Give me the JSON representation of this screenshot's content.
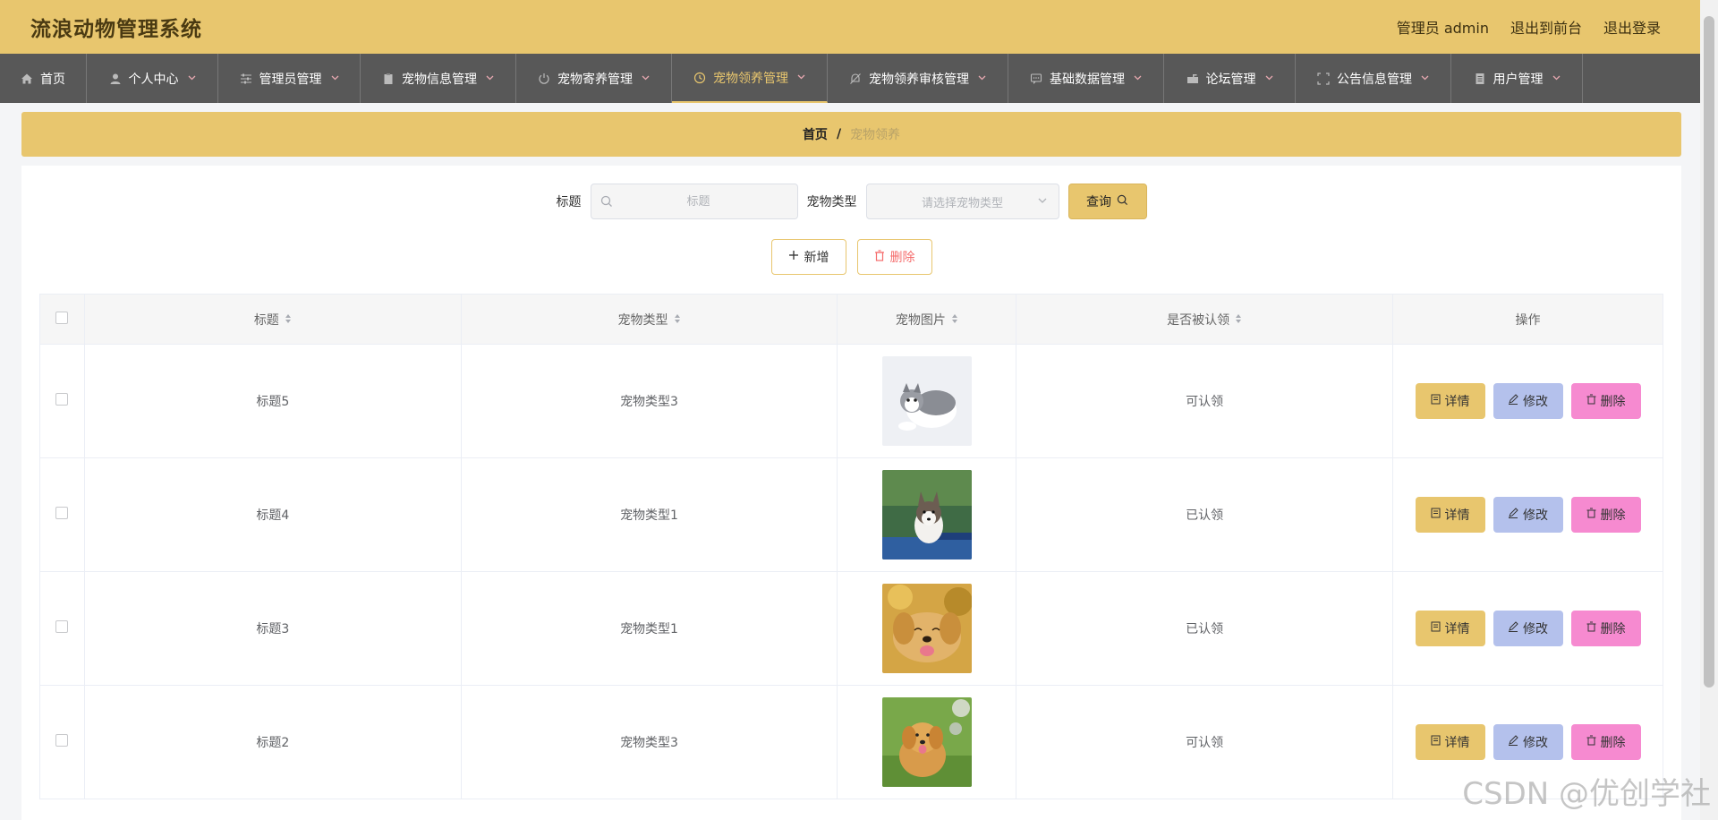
{
  "app": {
    "title": "流浪动物管理系统"
  },
  "header": {
    "user": "管理员 admin",
    "to_front": "退出到前台",
    "logout": "退出登录"
  },
  "nav": [
    {
      "label": "首页",
      "icon": "home-icon",
      "width": 97,
      "dropdown": false
    },
    {
      "label": "个人中心",
      "icon": "user-icon",
      "width": 147,
      "dropdown": true
    },
    {
      "label": "管理员管理",
      "icon": "sliders-icon",
      "width": 159,
      "dropdown": true
    },
    {
      "label": "宠物信息管理",
      "icon": "clipboard-icon",
      "width": 174,
      "dropdown": true
    },
    {
      "label": "宠物寄养管理",
      "icon": "power-icon",
      "width": 174,
      "dropdown": true
    },
    {
      "label": "宠物领养管理",
      "icon": "clock-icon",
      "width": 174,
      "dropdown": true,
      "active": true
    },
    {
      "label": "宠物领养审核管理",
      "icon": "bell-off-icon",
      "width": 202,
      "dropdown": true
    },
    {
      "label": "基础数据管理",
      "icon": "chat-icon",
      "width": 174,
      "dropdown": true
    },
    {
      "label": "论坛管理",
      "icon": "mailbox-icon",
      "width": 147,
      "dropdown": true
    },
    {
      "label": "公告信息管理",
      "icon": "frame-icon",
      "width": 174,
      "dropdown": true
    },
    {
      "label": "用户管理",
      "icon": "document-icon",
      "width": 147,
      "dropdown": true
    }
  ],
  "breadcrumb": {
    "home": "首页",
    "separator": "/",
    "current": "宠物领养"
  },
  "search": {
    "title_label": "标题",
    "title_placeholder": "标题",
    "type_label": "宠物类型",
    "type_placeholder": "请选择宠物类型",
    "query_button": "查询"
  },
  "actions": {
    "add": "新增",
    "delete": "删除"
  },
  "table": {
    "columns": [
      "标题",
      "宠物类型",
      "宠物图片",
      "是否被认领",
      "操作"
    ],
    "rows": [
      {
        "title": "标题5",
        "type": "宠物类型3",
        "image": "gray-cat-photo",
        "status": "可认领"
      },
      {
        "title": "标题4",
        "type": "宠物类型1",
        "image": "husky-photo",
        "status": "已认领"
      },
      {
        "title": "标题3",
        "type": "宠物类型1",
        "image": "golden-dog-face-photo",
        "status": "已认领"
      },
      {
        "title": "标题2",
        "type": "宠物类型3",
        "image": "golden-dog-grass-photo",
        "status": "可认领"
      }
    ],
    "ops": {
      "detail": "详情",
      "edit": "修改",
      "delete": "删除"
    }
  },
  "watermark": "CSDN @优创学社",
  "colors": {
    "primary": "#e8c66e",
    "nav_bg": "#585858",
    "edit_btn": "#b4c1ec",
    "delete_btn": "#f68ad0",
    "danger_text": "#f56c6c"
  }
}
